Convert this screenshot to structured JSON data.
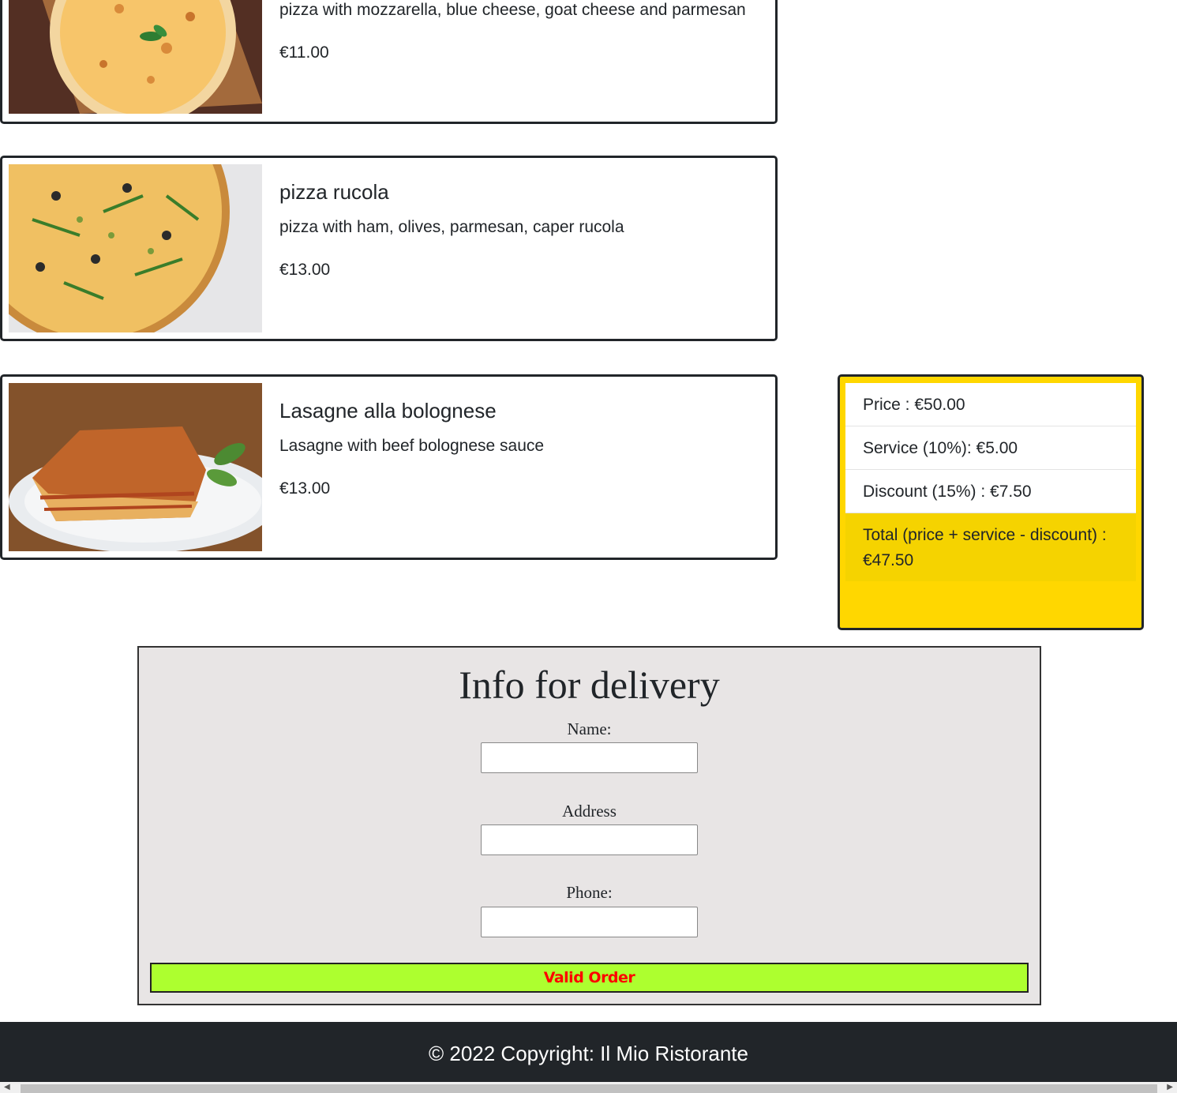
{
  "menu_items": [
    {
      "title": "",
      "description": "pizza with mozzarella, blue cheese, goat cheese and parmesan",
      "price": "€11.00",
      "image_icon": "pizza-cheese-image"
    },
    {
      "title": "pizza rucola",
      "description": "pizza with ham, olives, parmesan, caper rucola",
      "price": "€13.00",
      "image_icon": "pizza-rucola-image"
    },
    {
      "title": "Lasagne alla bolognese",
      "description": "Lasagne with beef bolognese sauce",
      "price": "€13.00",
      "image_icon": "lasagne-image"
    }
  ],
  "summary": {
    "price": "Price : €50.00",
    "service": "Service (10%): €5.00",
    "discount": "Discount (15%) : €7.50",
    "total": "Total (price + service - discount) : €47.50",
    "background_color": "#ffd700"
  },
  "delivery": {
    "title": "Info for delivery",
    "name_label": "Name:",
    "name_value": "",
    "address_label": "Address",
    "address_value": "",
    "phone_label": "Phone:",
    "phone_value": "",
    "submit_label": "Valid Order",
    "submit_color": "#adff2f"
  },
  "footer": {
    "text": "© 2022 Copyright: Il Mio Ristorante"
  }
}
